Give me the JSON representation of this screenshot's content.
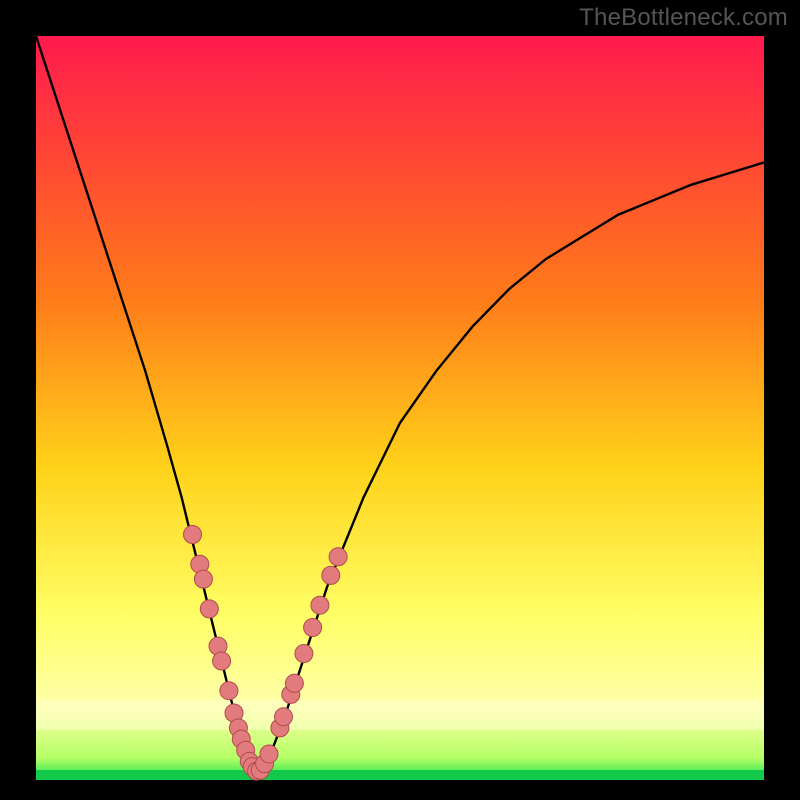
{
  "watermark": "TheBottleneck.com",
  "colors": {
    "black": "#000000",
    "grad_top": "#ff1a4d",
    "grad_mid1": "#ff7a1a",
    "grad_mid2": "#ffd21a",
    "grad_mid3": "#ffff66",
    "grad_band": "#ffffaa",
    "grad_green": "#1adf4f",
    "curve": "#000000",
    "marker_fill": "#e27b7d",
    "marker_stroke": "#b24b4d"
  },
  "chart_data": {
    "type": "line",
    "title": "",
    "xlabel": "",
    "ylabel": "",
    "xlim": [
      0,
      100
    ],
    "ylim": [
      0,
      100
    ],
    "series": [
      {
        "name": "bottleneck-curve",
        "x": [
          0,
          5,
          10,
          15,
          18,
          20,
          22,
          24,
          26,
          27,
          28,
          29,
          30,
          31,
          32,
          34,
          36,
          38,
          40,
          45,
          50,
          55,
          60,
          65,
          70,
          75,
          80,
          85,
          90,
          95,
          100
        ],
        "y": [
          100,
          85,
          70,
          55,
          45,
          38,
          30,
          22,
          14,
          10,
          6,
          3,
          1,
          1,
          3,
          8,
          14,
          20,
          26,
          38,
          48,
          55,
          61,
          66,
          70,
          73,
          76,
          78,
          80,
          81.5,
          83
        ]
      }
    ],
    "markers": {
      "name": "highlight-points",
      "points": [
        {
          "x": 21.5,
          "y": 33
        },
        {
          "x": 22.5,
          "y": 29
        },
        {
          "x": 23.0,
          "y": 27
        },
        {
          "x": 23.8,
          "y": 23
        },
        {
          "x": 25.0,
          "y": 18
        },
        {
          "x": 25.5,
          "y": 16
        },
        {
          "x": 26.5,
          "y": 12
        },
        {
          "x": 27.2,
          "y": 9
        },
        {
          "x": 27.8,
          "y": 7
        },
        {
          "x": 28.2,
          "y": 5.5
        },
        {
          "x": 28.8,
          "y": 4
        },
        {
          "x": 29.3,
          "y": 2.5
        },
        {
          "x": 29.7,
          "y": 1.8
        },
        {
          "x": 30.3,
          "y": 1.2
        },
        {
          "x": 30.8,
          "y": 1.3
        },
        {
          "x": 31.4,
          "y": 2.2
        },
        {
          "x": 32.0,
          "y": 3.5
        },
        {
          "x": 33.5,
          "y": 7
        },
        {
          "x": 34.0,
          "y": 8.5
        },
        {
          "x": 35.0,
          "y": 11.5
        },
        {
          "x": 35.5,
          "y": 13
        },
        {
          "x": 36.8,
          "y": 17
        },
        {
          "x": 38.0,
          "y": 20.5
        },
        {
          "x": 39.0,
          "y": 23.5
        },
        {
          "x": 40.5,
          "y": 27.5
        },
        {
          "x": 41.5,
          "y": 30
        }
      ]
    }
  }
}
